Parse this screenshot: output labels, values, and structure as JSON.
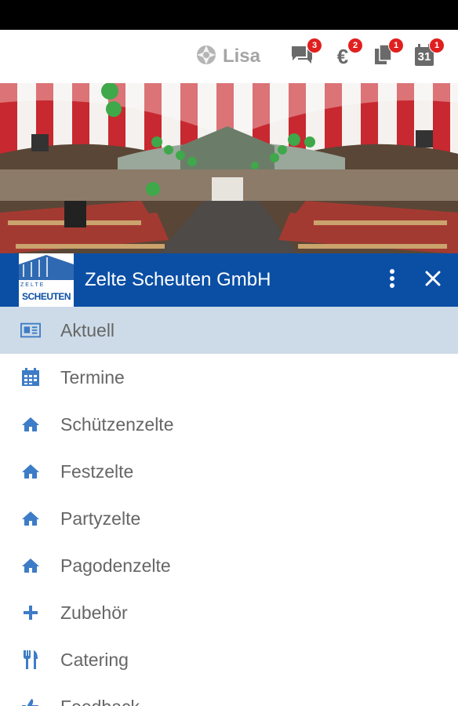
{
  "top_bar": {
    "user_name": "Lisa",
    "badges": {
      "messages": "3",
      "payments": "2",
      "documents": "1",
      "calendar": "1"
    },
    "calendar_day": "31"
  },
  "drawer": {
    "title": "Zelte Scheuten GmbH",
    "logo_text": "SCHEUTEN",
    "logo_small_text": "ZELTE",
    "items": [
      {
        "label": "Aktuell",
        "icon": "newspaper-icon",
        "active": true
      },
      {
        "label": "Termine",
        "icon": "calendar-icon",
        "active": false
      },
      {
        "label": "Schützenzelte",
        "icon": "home-icon",
        "active": false
      },
      {
        "label": "Festzelte",
        "icon": "home-icon",
        "active": false
      },
      {
        "label": "Partyzelte",
        "icon": "home-icon",
        "active": false
      },
      {
        "label": "Pagodenzelte",
        "icon": "home-icon",
        "active": false
      },
      {
        "label": "Zubehör",
        "icon": "plus-icon",
        "active": false
      },
      {
        "label": "Catering",
        "icon": "cutlery-icon",
        "active": false
      },
      {
        "label": "Feedback",
        "icon": "thumbs-up-icon",
        "active": false
      }
    ]
  },
  "colors": {
    "brand": "#0b4fa5",
    "active_item": "#cddbe8",
    "icon": "#3d7cc6",
    "badge": "#e0201f"
  }
}
